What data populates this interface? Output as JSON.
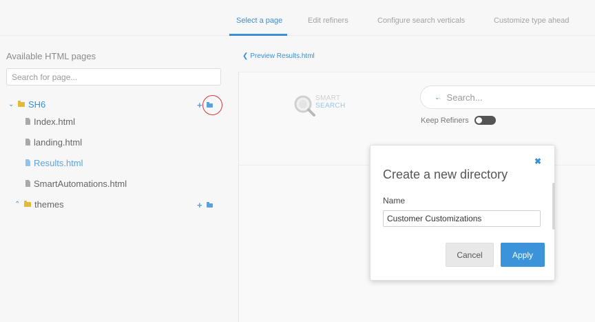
{
  "tabs": [
    {
      "label": "Select a page",
      "active": true
    },
    {
      "label": "Edit refiners",
      "active": false
    },
    {
      "label": "Configure search verticals",
      "active": false
    },
    {
      "label": "Customize type ahead",
      "active": false
    }
  ],
  "left_panel": {
    "title": "Available HTML pages",
    "search_placeholder": "Search for page...",
    "tree": {
      "root": {
        "label": "SH6",
        "expanded": true
      },
      "files": [
        "Index.html",
        "landing.html",
        "Results.html",
        "SmartAutomations.html"
      ],
      "active_file": "Results.html",
      "sub": {
        "label": "themes",
        "expanded": false
      }
    }
  },
  "preview": {
    "link_label": "Preview Results.html",
    "logo_top": "SMART",
    "logo_bottom": "SEARCH",
    "search_placeholder": "Search...",
    "keep_refiners_label": "Keep Refiners",
    "keep_refiners_on": false
  },
  "modal": {
    "close_icon": "close-icon",
    "title": "Create a new directory",
    "name_label": "Name",
    "name_value": "Customer Customizations",
    "cancel_label": "Cancel",
    "apply_label": "Apply"
  },
  "colors": {
    "accent": "#3a8fd6",
    "apply_button": "#3b94d9",
    "folder": "#e3b93a",
    "highlight_circle": "#d63a3a"
  }
}
